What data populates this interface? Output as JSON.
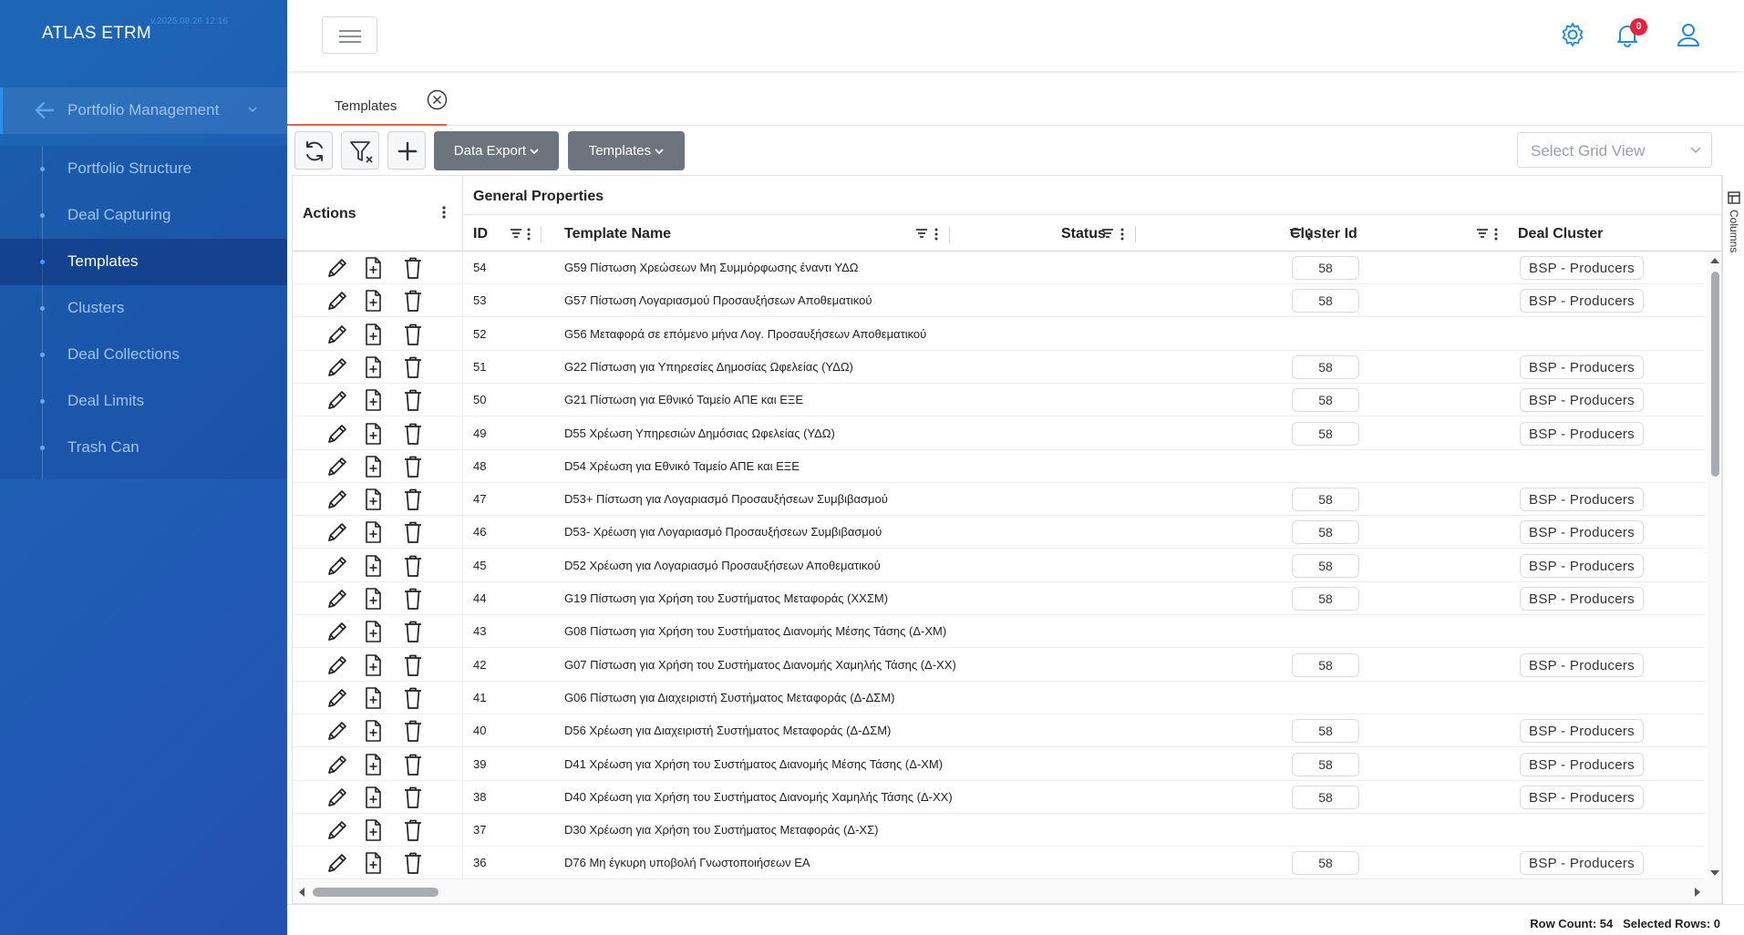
{
  "app": {
    "brand": "ATLAS ETRM",
    "build_stamp": "v.2025.08.26 12:16"
  },
  "sidebar": {
    "parent": {
      "label": "Portfolio Management",
      "icon": "arrow-left-icon"
    },
    "items": [
      {
        "label": "Portfolio Structure"
      },
      {
        "label": "Deal Capturing"
      },
      {
        "label": "Templates"
      },
      {
        "label": "Clusters"
      },
      {
        "label": "Deal Collections"
      },
      {
        "label": "Deal Limits"
      },
      {
        "label": "Trash Can"
      }
    ],
    "active": "Templates"
  },
  "topbar": {
    "notification_count": "0",
    "icons": [
      "gear-icon",
      "bell-icon",
      "user-icon"
    ]
  },
  "tabs": [
    {
      "label": "Templates"
    }
  ],
  "toolbar": {
    "data_export": "Data Export",
    "templates": "Templates",
    "grid_view_placeholder": "Select Grid View"
  },
  "grid": {
    "actions_header": "Actions",
    "group_header": "General Properties",
    "columns": {
      "id": "ID",
      "name": "Template Name",
      "status": "Status",
      "cluster_id": "Cluster Id",
      "deal_cluster": "Deal Cluster"
    },
    "side_panel": "Columns",
    "rows": [
      {
        "id": "54",
        "name": "G59  Πίστωση Χρεώσεων Μη Συμμόρφωσης έναντι ΥΔΩ",
        "cluster_id": "58",
        "deal_cluster": "BSP - Producers"
      },
      {
        "id": "53",
        "name": "G57  Πίστωση Λογαριασμού Προσαυξήσεων Αποθεματικού",
        "cluster_id": "58",
        "deal_cluster": "BSP - Producers"
      },
      {
        "id": "52",
        "name": "G56  Μεταφορά σε επόμενο μήνα Λογ. Προσαυξήσεων Αποθεματικού",
        "cluster_id": "",
        "deal_cluster": ""
      },
      {
        "id": "51",
        "name": "G22  Πίστωση για Υπηρεσίες Δημοσίας Ωφελείας (ΥΔΩ)",
        "cluster_id": "58",
        "deal_cluster": "BSP - Producers"
      },
      {
        "id": "50",
        "name": "G21  Πίστωση για Εθνικό Ταμείο ΑΠΕ και ΕΞΕ",
        "cluster_id": "58",
        "deal_cluster": "BSP - Producers"
      },
      {
        "id": "49",
        "name": "D55  Χρέωση Υπηρεσιών Δημόσιας Ωφελείας (ΥΔΩ)",
        "cluster_id": "58",
        "deal_cluster": "BSP - Producers"
      },
      {
        "id": "48",
        "name": "D54  Χρέωση για Εθνικό Ταμείο ΑΠΕ και ΕΞΕ",
        "cluster_id": "",
        "deal_cluster": ""
      },
      {
        "id": "47",
        "name": "D53+  Πίστωση για Λογαριασμό Προσαυξήσεων Συμβιβασμού",
        "cluster_id": "58",
        "deal_cluster": "BSP - Producers"
      },
      {
        "id": "46",
        "name": "D53-  Χρέωση για Λογαριασμό Προσαυξήσεων Συμβιβασμού",
        "cluster_id": "58",
        "deal_cluster": "BSP - Producers"
      },
      {
        "id": "45",
        "name": "D52  Χρέωση για Λογαριασμό Προσαυξήσεων Αποθεματικού",
        "cluster_id": "58",
        "deal_cluster": "BSP - Producers"
      },
      {
        "id": "44",
        "name": "G19  Πίστωση για Χρήση του Συστήματος Μεταφοράς (ΧΧΣΜ)",
        "cluster_id": "58",
        "deal_cluster": "BSP - Producers"
      },
      {
        "id": "43",
        "name": "G08  Πίστωση για Χρήση του Συστήματος Διανομής Μέσης Τάσης (Δ-ΧΜ)",
        "cluster_id": "",
        "deal_cluster": ""
      },
      {
        "id": "42",
        "name": "G07  Πίστωση για Χρήση του Συστήματος Διανομής Χαμηλής Τάσης (Δ-ΧΧ)",
        "cluster_id": "58",
        "deal_cluster": "BSP - Producers"
      },
      {
        "id": "41",
        "name": "G06  Πίστωση για Διαχειριστή Συστήματος Μεταφοράς (Δ-ΔΣΜ)",
        "cluster_id": "",
        "deal_cluster": ""
      },
      {
        "id": "40",
        "name": "D56  Χρέωση για Διαχειριστή Συστήματος Μεταφοράς (Δ-ΔΣΜ)",
        "cluster_id": "58",
        "deal_cluster": "BSP - Producers"
      },
      {
        "id": "39",
        "name": "D41  Χρέωση για Χρήση του Συστήματος Διανομής Μέσης Τάσης (Δ-ΧΜ)",
        "cluster_id": "58",
        "deal_cluster": "BSP - Producers"
      },
      {
        "id": "38",
        "name": "D40  Χρέωση για Χρήση του Συστήματος Διανομής Χαμηλής Τάσης (Δ-ΧΧ)",
        "cluster_id": "58",
        "deal_cluster": "BSP - Producers"
      },
      {
        "id": "37",
        "name": "D30  Χρέωση για Χρήση του Συστήματος Μεταφοράς (Δ-ΧΣ)",
        "cluster_id": "",
        "deal_cluster": ""
      },
      {
        "id": "36",
        "name": "D76  Μη έγκυρη υποβολή Γνωστοποιήσεων ΕΑ",
        "cluster_id": "58",
        "deal_cluster": "BSP - Producers"
      }
    ]
  },
  "footer": {
    "status": "Row Count: 54   Selected Rows: 0"
  }
}
